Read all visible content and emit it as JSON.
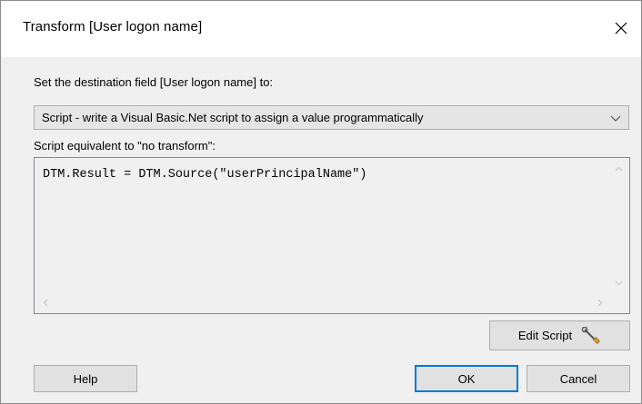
{
  "dialog": {
    "title": "Transform [User logon name]",
    "close_icon": "close-icon"
  },
  "destination_label": "Set the destination field [User logon name] to:",
  "transform_select": {
    "selected": "Script - write a Visual Basic.Net script to assign a value programmatically",
    "arrow_icon": "chevron-down-icon"
  },
  "script_label": "Script equivalent to \"no transform\":",
  "script_code": "DTM.Result = DTM.Source(\"userPrincipalName\")",
  "buttons": {
    "edit_script": "Edit Script",
    "edit_script_icon": "wrench-icon",
    "help": "Help",
    "ok": "OK",
    "cancel": "Cancel"
  },
  "colors": {
    "accent": "#0078d7",
    "dialog_bg": "#f0f0f0",
    "titlebar_bg": "#ffffff"
  }
}
